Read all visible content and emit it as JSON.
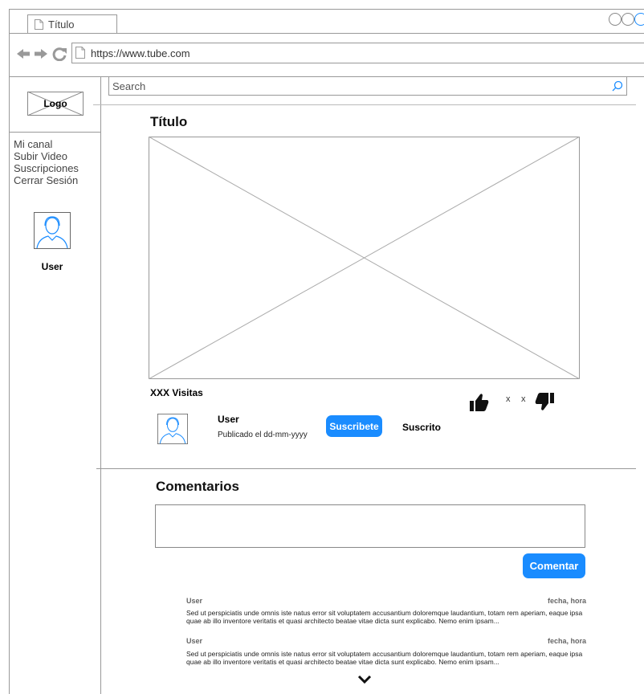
{
  "browser": {
    "tab_title": "Título",
    "url": "https://www.tube.com"
  },
  "sidebar": {
    "logo": "Logo",
    "menu": [
      "Mi canal",
      "Subir Video",
      "Suscripciones",
      "Cerrar Sesión"
    ],
    "user": "User"
  },
  "search": {
    "placeholder": "Search"
  },
  "video": {
    "title": "Título",
    "views": "XXX Visitas",
    "likes": "x",
    "dislikes": "x",
    "owner": "User",
    "published": "Publicado el dd-mm-yyyy",
    "subscribe_label": "Suscribete",
    "subscribed_label": "Suscrito"
  },
  "comments": {
    "title": "Comentarios",
    "submit_label": "Comentar",
    "items": [
      {
        "user": "User",
        "date": "fecha, hora",
        "text": "Sed ut perspiciatis unde omnis iste natus error sit voluptatem accusantium doloremque laudantium, totam rem aperiam, eaque ipsa quae ab illo inventore veritatis et quasi architecto beatae vitae dicta sunt explicabo. Nemo enim ipsam..."
      },
      {
        "user": "User",
        "date": "fecha, hora",
        "text": "Sed ut perspiciatis unde omnis iste natus error sit voluptatem accusantium doloremque laudantium, totam rem aperiam, eaque ipsa quae ab illo inventore veritatis et quasi architecto beatae vitae dicta sunt explicabo. Nemo enim ipsam..."
      }
    ]
  },
  "colors": {
    "accent": "#1a8cff",
    "search_icon": "#1a8cff",
    "border": "#999999"
  }
}
